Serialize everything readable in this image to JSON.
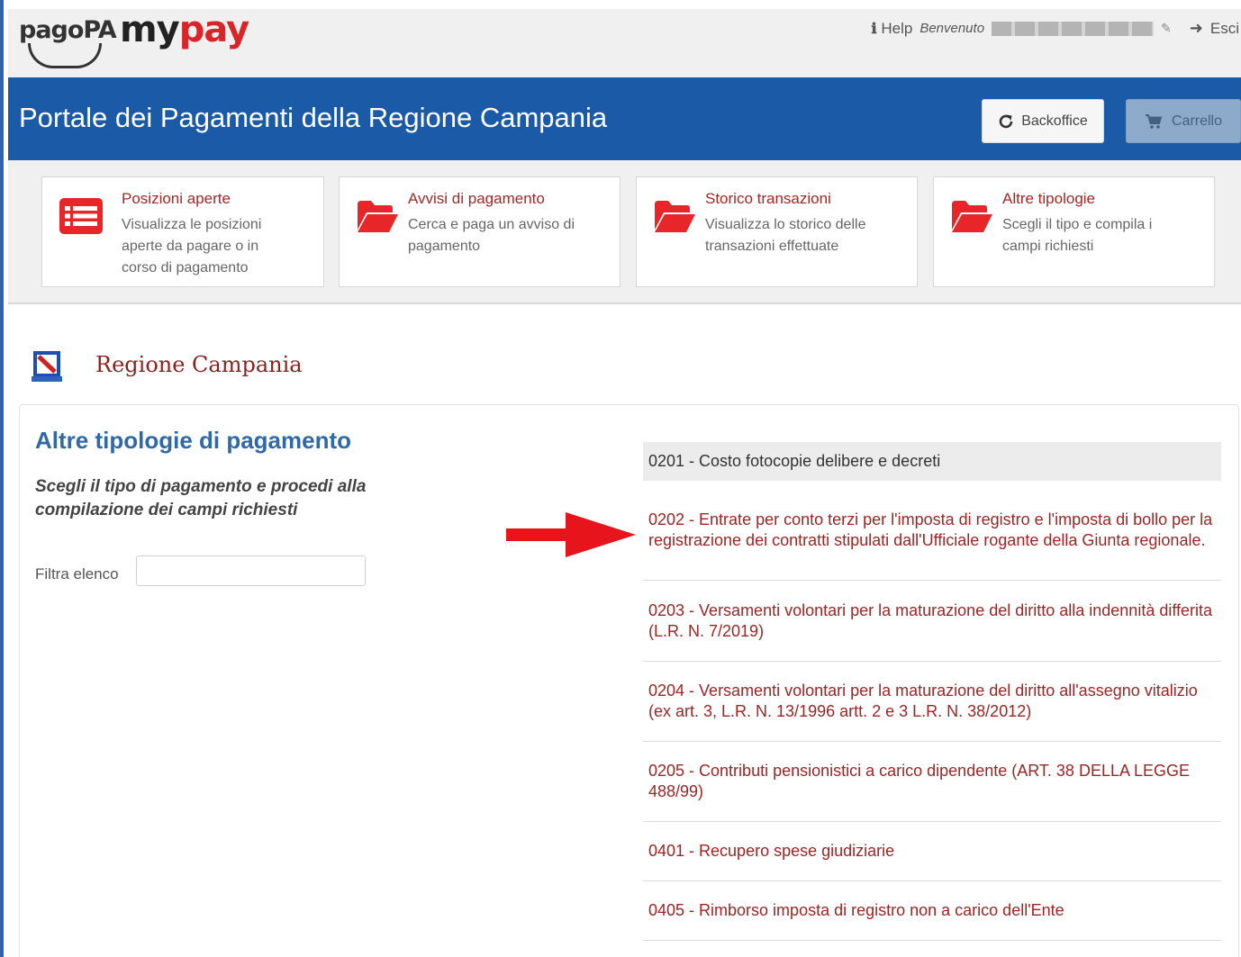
{
  "topbar": {
    "logo_pagopa": "pagoPA",
    "logo_my": "my",
    "logo_pay": "pay",
    "help_label": "Help",
    "welcome_label": "Benvenuto",
    "logout_label": "Esci"
  },
  "header": {
    "title": "Portale dei Pagamenti della Regione Campania",
    "backoffice_label": "Backoffice",
    "cart_label": "Carrello"
  },
  "cards": [
    {
      "title": "Posizioni aperte",
      "desc": "Visualizza le posizioni aperte da pagare o in corso di pagamento",
      "icon": "list-icon"
    },
    {
      "title": "Avvisi di pagamento",
      "desc": "Cerca e paga un avviso di pagamento",
      "icon": "folder-open-icon"
    },
    {
      "title": "Storico transazioni",
      "desc": "Visualizza lo storico delle transazioni effettuate",
      "icon": "folder-open-icon"
    },
    {
      "title": "Altre tipologie",
      "desc": "Scegli il tipo e compila i campi richiesti",
      "icon": "folder-open-icon"
    }
  ],
  "region": {
    "name": "Regione Campania"
  },
  "main": {
    "title": "Altre tipologie di pagamento",
    "subtitle": "Scegli il tipo di pagamento e procedi alla compilazione dei campi richiesti",
    "filter_label": "Filtra elenco",
    "filter_value": ""
  },
  "payment_types": [
    "0201 - Costo fotocopie delibere e decreti",
    "0202 - Entrate per conto terzi per l'imposta di registro e l'imposta di bollo per la registrazione dei contratti stipulati dall'Ufficiale rogante della Giunta regionale.",
    "0203 - Versamenti volontari per la maturazione del diritto alla indennità differita (L.R. N. 7/2019)",
    "0204 - Versamenti volontari per la maturazione del diritto all'assegno vitalizio (ex art. 3, L.R. N. 13/1996 artt. 2 e 3 L.R. N. 38/2012)",
    "0205 - Contributi pensionistici a carico dipendente (ART. 38 DELLA LEGGE 488/99)",
    "0401 - Recupero spese giudiziarie",
    "0405 - Rimborso imposta di registro non a carico dell'Ente"
  ],
  "colors": {
    "header_blue": "#1a5aa6",
    "accent_red": "#a32826",
    "title_blue": "#2f6aa6",
    "arrow_red": "#e8141b"
  }
}
